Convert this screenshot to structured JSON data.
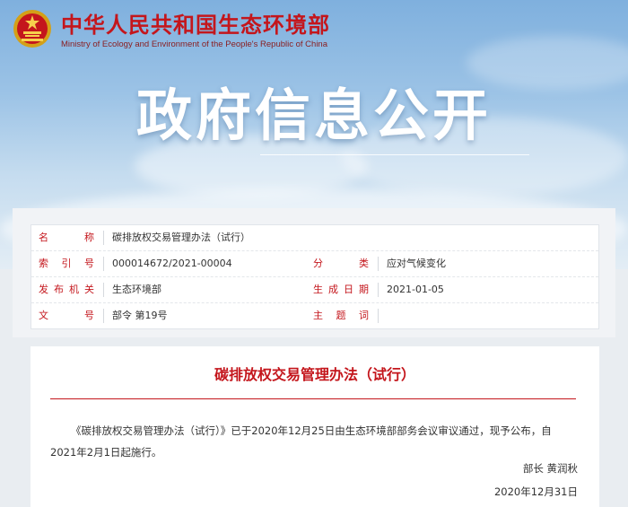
{
  "header": {
    "site_name": "中华人民共和国生态环境部",
    "site_name_en": "Ministry of Ecology and Environment of the People's Republic of China",
    "banner_title": "政府信息公开",
    "colors": {
      "brand_red": "#c4161c",
      "sky": "#9cc3e6"
    }
  },
  "meta": {
    "name_label": "名　　称",
    "name_value": "碳排放权交易管理办法（试行）",
    "index_label": "索 引 号",
    "index_value": "000014672/2021-00004",
    "category_label": "分　　类",
    "category_value": "应对气候变化",
    "issuer_label": "发布机关",
    "issuer_value": "生态环境部",
    "date_label": "生成日期",
    "date_value": "2021-01-05",
    "docno_label": "文　　号",
    "docno_value": "部令 第19号",
    "subject_label": "主 题 词",
    "subject_value": ""
  },
  "article": {
    "title": "碳排放权交易管理办法（试行）",
    "body": "《碳排放权交易管理办法（试行）》已于2020年12月25日由生态环境部部务会议审议通过，现予公布，自2021年2月1日起施行。",
    "signer": "部长 黄润秋",
    "date": "2020年12月31日"
  }
}
